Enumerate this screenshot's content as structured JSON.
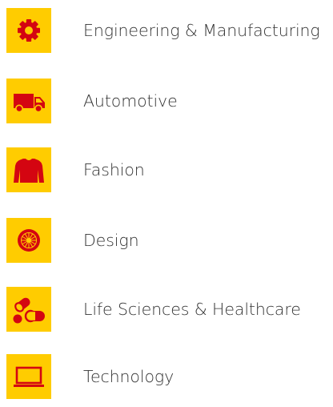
{
  "colors": {
    "tile_background": "#FFCC00",
    "icon_color": "#D40511",
    "label_color": "#333333",
    "page_background": "#FFFFFF"
  },
  "industries": [
    {
      "label": "Engineering & Manufacturing",
      "icon": "gear-icon"
    },
    {
      "label": "Automotive",
      "icon": "van-icon"
    },
    {
      "label": "Fashion",
      "icon": "sweater-icon"
    },
    {
      "label": "Design",
      "icon": "tire-icon"
    },
    {
      "label": "Life Sciences & Healthcare",
      "icon": "pills-icon"
    },
    {
      "label": "Technology",
      "icon": "laptop-icon"
    }
  ]
}
